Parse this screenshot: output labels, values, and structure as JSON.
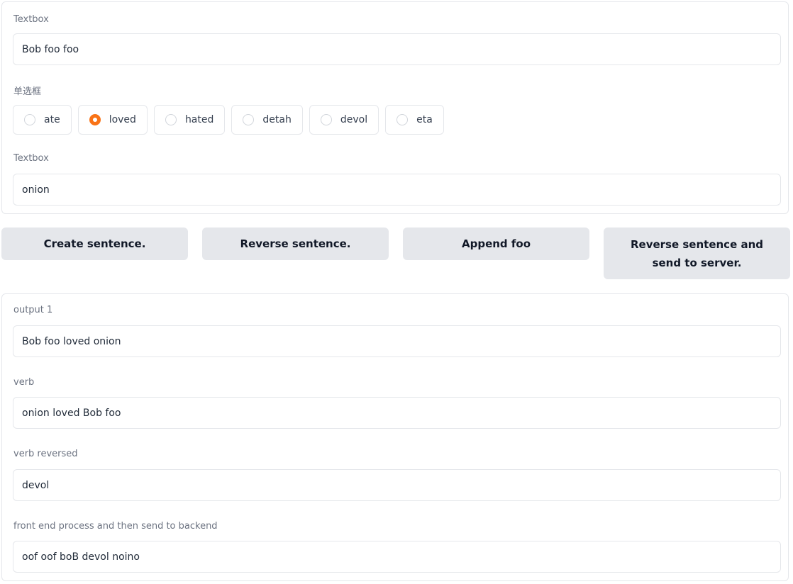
{
  "inputs_panel": {
    "textbox1": {
      "label": "Textbox",
      "value": "Bob foo foo"
    },
    "radio_group": {
      "label": "单选框",
      "selected": "loved",
      "options": [
        "ate",
        "loved",
        "hated",
        "detah",
        "devol",
        "eta"
      ]
    },
    "textbox2": {
      "label": "Textbox",
      "value": "onion"
    }
  },
  "buttons": [
    "Create sentence.",
    "Reverse sentence.",
    "Append foo",
    "Reverse sentence and send to server."
  ],
  "outputs_panel": {
    "output1": {
      "label": "output 1",
      "value": "Bob foo loved onion"
    },
    "verb": {
      "label": "verb",
      "value": "onion loved Bob foo"
    },
    "verb_reversed": {
      "label": "verb reversed",
      "value": "devol"
    },
    "frontend": {
      "label": "front end process and then send to backend",
      "value": "oof oof boB devol noino"
    }
  },
  "colors": {
    "accent": "#f97316",
    "button_bg": "#e5e7eb",
    "border": "#e5e7eb"
  }
}
